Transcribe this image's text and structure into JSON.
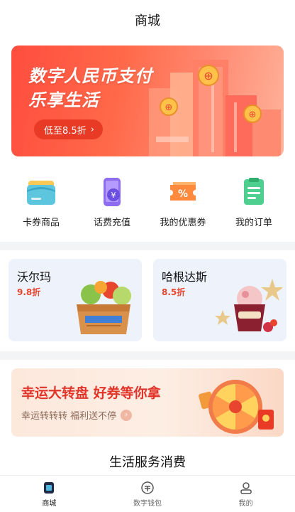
{
  "header": {
    "title": "商城"
  },
  "banner": {
    "line1": "数字人民币支付",
    "line2": "乐享生活",
    "cta": "低至8.5折",
    "colors": {
      "bg_start": "#ff4d3e",
      "cta_bg": "#e83a25"
    }
  },
  "quick_entries": [
    {
      "label": "卡券商品",
      "icon": "card-coupon-icon"
    },
    {
      "label": "话费充值",
      "icon": "phone-recharge-icon"
    },
    {
      "label": "我的优惠券",
      "icon": "discount-coupon-icon"
    },
    {
      "label": "我的订单",
      "icon": "order-list-icon"
    }
  ],
  "merchants": [
    {
      "name": "沃尔玛",
      "discount": "9.8折",
      "icon": "grocery-basket-icon"
    },
    {
      "name": "哈根达斯",
      "discount": "8.5折",
      "icon": "ice-cream-icon"
    }
  ],
  "lucky_wheel": {
    "title": "幸运大转盘 好券等你拿",
    "subtitle": "幸运转转转 福利送不停"
  },
  "section": {
    "title": "生活服务消费"
  },
  "tabbar": [
    {
      "label": "商城",
      "icon": "mall-icon",
      "active": true
    },
    {
      "label": "数字钱包",
      "icon": "wallet-icon",
      "active": false
    },
    {
      "label": "我的",
      "icon": "profile-icon",
      "active": false
    }
  ]
}
